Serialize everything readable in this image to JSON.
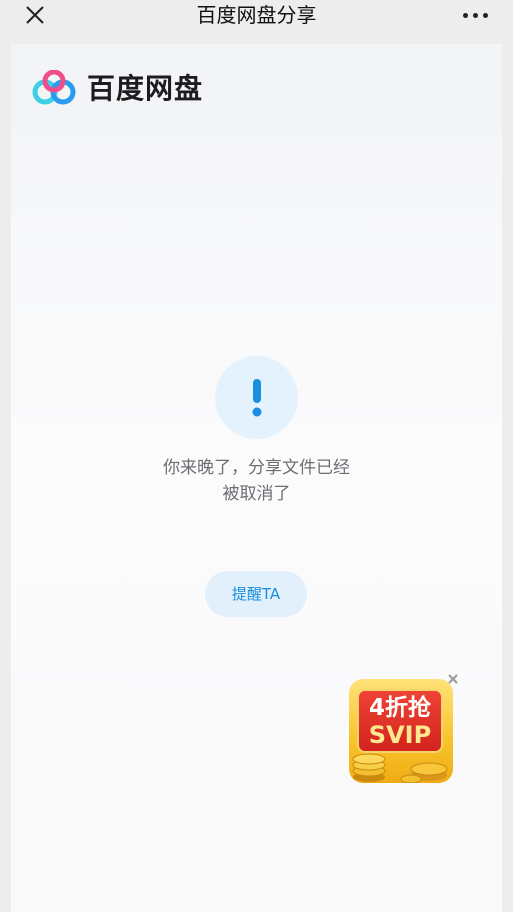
{
  "navbar": {
    "title": "百度网盘分享",
    "close_icon": "close-icon",
    "more_icon": "more-dots-icon"
  },
  "brand": {
    "name": "百度网盘",
    "logo_icon": "baidu-netdisk-logo",
    "colors": {
      "blue": "#2a9cf0",
      "cyan": "#3fd0e8",
      "pink": "#ee4f8a"
    }
  },
  "message": {
    "icon": "exclamation-icon",
    "line1": "你来晚了，分享文件已经",
    "line2": "被取消了"
  },
  "remind_button": {
    "label": "提醒TA"
  },
  "promo": {
    "line1": "4折抢",
    "line2": "SVIP",
    "close_icon": "close-icon"
  },
  "colors": {
    "accent": "#1a8ee1",
    "icon_bg": "#e4f2fd",
    "promo_red": "#e0342a",
    "promo_gold": "#f8c32b"
  }
}
